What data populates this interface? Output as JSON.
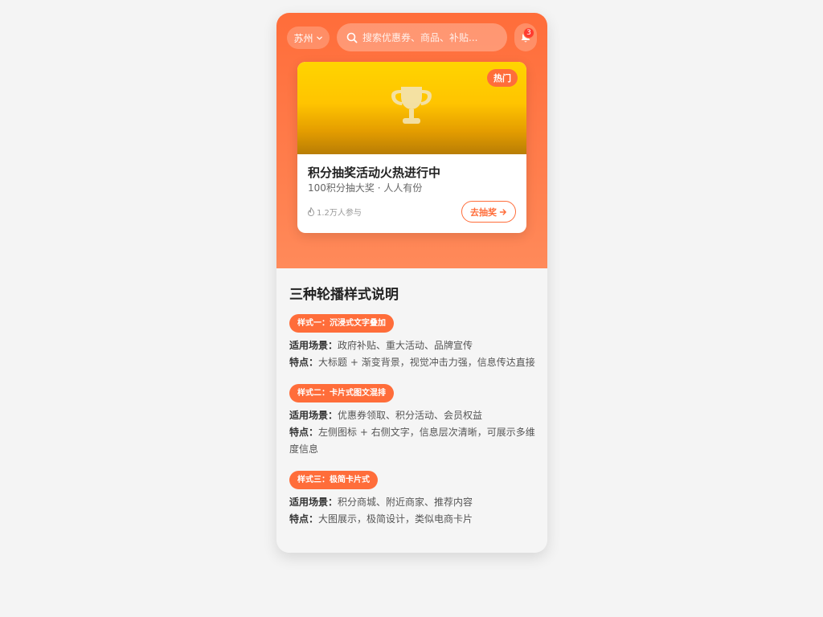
{
  "header": {
    "city": "苏州",
    "search_placeholder": "搜索优惠券、商品、补贴...",
    "notification_count": "3"
  },
  "promo": {
    "tag": "热门",
    "title": "积分抽奖活动火热进行中",
    "subtitle": "100积分抽大奖 · 人人有份",
    "participants": "1.2万人参与",
    "cta": "去抽奖"
  },
  "info": {
    "title": "三种轮播样式说明",
    "styles": [
      {
        "tag": "样式一：沉浸式文字叠加",
        "scenario_label": "适用场景：",
        "scenario": "政府补贴、重大活动、品牌宣传",
        "feature_label": "特点：",
        "feature": "大标题 + 渐变背景，视觉冲击力强，信息传达直接"
      },
      {
        "tag": "样式二：卡片式图文混排",
        "scenario_label": "适用场景：",
        "scenario": "优惠券领取、积分活动、会员权益",
        "feature_label": "特点：",
        "feature": "左侧图标 + 右侧文字，信息层次清晰，可展示多维度信息"
      },
      {
        "tag": "样式三：极简卡片式",
        "scenario_label": "适用场景：",
        "scenario": "积分商城、附近商家、推荐内容",
        "feature_label": "特点：",
        "feature": "大图展示，极简设计，类似电商卡片"
      }
    ]
  },
  "colors": {
    "accent": "#ff6d3a",
    "badge": "#ff3b30"
  }
}
